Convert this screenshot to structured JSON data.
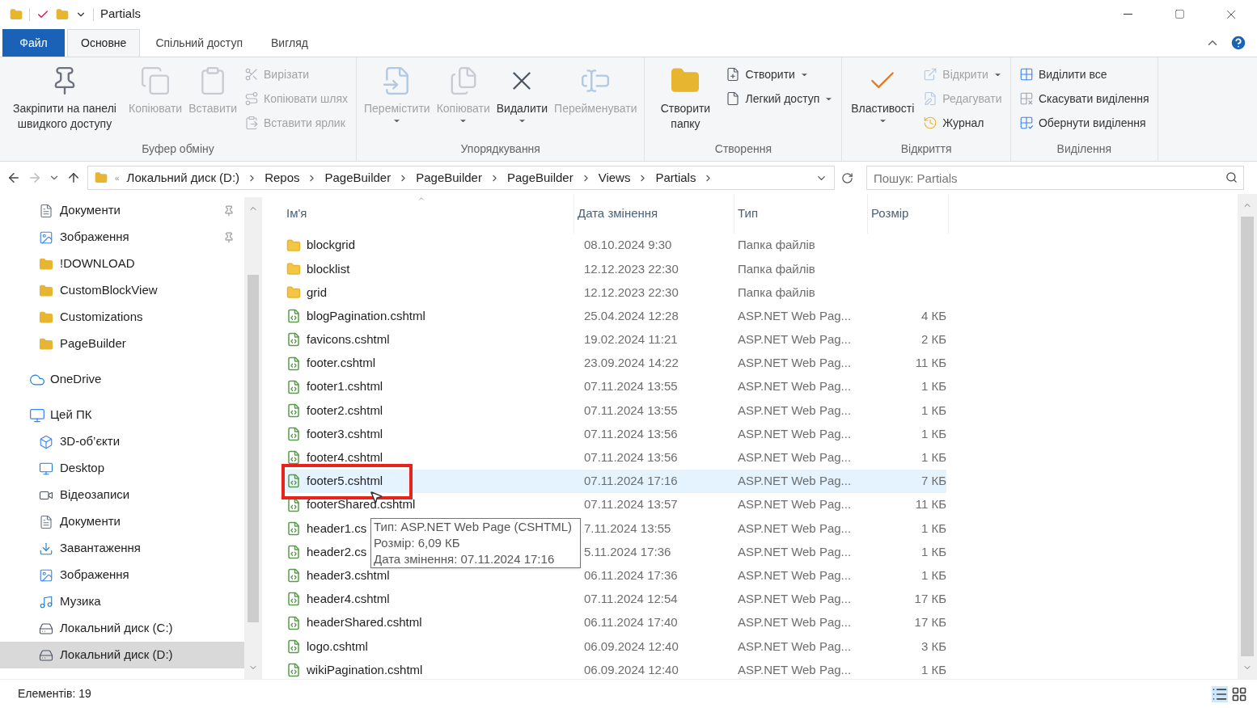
{
  "window": {
    "title": "Partials"
  },
  "ribbon_tabs": [
    {
      "label": "Файл",
      "kind": "file",
      "selected": false
    },
    {
      "label": "Основне",
      "kind": "tab",
      "selected": true
    },
    {
      "label": "Спільний доступ",
      "kind": "tab",
      "selected": false
    },
    {
      "label": "Вигляд",
      "kind": "tab",
      "selected": false
    }
  ],
  "ribbon_groups": [
    {
      "label": "Буфер обміну",
      "large": [
        {
          "label": "Закріпити на панелі швидкого доступу",
          "kind": "pin",
          "disabled": false,
          "dropdown": false
        },
        {
          "label": "Копіювати",
          "kind": "copy",
          "disabled": true,
          "dropdown": false
        },
        {
          "label": "Вставити",
          "kind": "paste",
          "disabled": true,
          "dropdown": false
        }
      ],
      "small": [
        {
          "label": "Вирізати",
          "kind": "cut",
          "disabled": true,
          "dropdown": false
        },
        {
          "label": "Копіювати шлях",
          "kind": "copy_path",
          "disabled": true,
          "dropdown": false
        },
        {
          "label": "Вставити ярлик",
          "kind": "paste_shortcut",
          "disabled": true,
          "dropdown": false
        }
      ]
    },
    {
      "label": "Упорядкування",
      "large": [
        {
          "label": "Перемістити",
          "kind": "move",
          "disabled": true,
          "dropdown": true
        },
        {
          "label": "Копіювати",
          "kind": "copy_to",
          "disabled": true,
          "dropdown": true
        },
        {
          "label": "Видалити",
          "kind": "delete",
          "disabled": false,
          "dropdown": true
        },
        {
          "label": "Перейменувати",
          "kind": "rename",
          "disabled": true,
          "dropdown": false
        }
      ]
    },
    {
      "label": "Створення",
      "large": [
        {
          "label": "Створити папку",
          "kind": "new_folder",
          "disabled": false,
          "dropdown": false
        }
      ],
      "small": [
        {
          "label": "Створити",
          "kind": "new_item",
          "disabled": false,
          "dropdown": true
        },
        {
          "label": "Легкий доступ",
          "kind": "easy_access",
          "disabled": false,
          "dropdown": true
        }
      ]
    },
    {
      "label": "Відкриття",
      "large": [
        {
          "label": "Властивості",
          "kind": "properties",
          "disabled": false,
          "dropdown": true
        }
      ],
      "small": [
        {
          "label": "Відкрити",
          "kind": "open",
          "disabled": true,
          "dropdown": true
        },
        {
          "label": "Редагувати",
          "kind": "edit",
          "disabled": true,
          "dropdown": false
        },
        {
          "label": "Журнал",
          "kind": "history",
          "disabled": false,
          "dropdown": false
        }
      ]
    },
    {
      "label": "Виділення",
      "small": [
        {
          "label": "Виділити все",
          "kind": "select_all",
          "disabled": false,
          "dropdown": false
        },
        {
          "label": "Скасувати виділення",
          "kind": "select_none",
          "disabled": false,
          "dropdown": false
        },
        {
          "label": "Обернути виділення",
          "kind": "invert",
          "disabled": false,
          "dropdown": false
        }
      ]
    }
  ],
  "address": {
    "overflow": "«",
    "path": [
      "Локальний диск (D:)",
      "Repos",
      "PageBuilder",
      "PageBuilder",
      "PageBuilder",
      "Views",
      "Partials"
    ]
  },
  "search": {
    "placeholder": "Пошук: Partials"
  },
  "sidebar": {
    "quick_access": [
      {
        "label": "Документи",
        "kind": "docs",
        "pinned": true,
        "selected": false
      },
      {
        "label": "Зображення",
        "kind": "pictures",
        "pinned": true,
        "selected": false
      },
      {
        "label": "!DOWNLOAD",
        "kind": "folder",
        "pinned": false,
        "selected": false
      },
      {
        "label": "CustomBlockView",
        "kind": "folder",
        "pinned": false,
        "selected": false
      },
      {
        "label": "Customizations",
        "kind": "folder",
        "pinned": false,
        "selected": false
      },
      {
        "label": "PageBuilder",
        "kind": "folder",
        "pinned": false,
        "selected": false
      }
    ],
    "tree": [
      {
        "label": "OneDrive",
        "kind": "cloud",
        "selected": false
      },
      {
        "label": "Цей ПК",
        "kind": "pc",
        "selected": false,
        "children": [
          {
            "label": "3D-об’єкти",
            "kind": "objects",
            "selected": false
          },
          {
            "label": "Desktop",
            "kind": "desktop",
            "selected": false
          },
          {
            "label": "Відеозаписи",
            "kind": "video",
            "selected": false
          },
          {
            "label": "Документи",
            "kind": "docs",
            "selected": false
          },
          {
            "label": "Завантаження",
            "kind": "download",
            "selected": false
          },
          {
            "label": "Зображення",
            "kind": "pictures",
            "selected": false
          },
          {
            "label": "Музика",
            "kind": "music",
            "selected": false
          },
          {
            "label": "Локальний диск (C:)",
            "kind": "drive",
            "selected": false
          },
          {
            "label": "Локальний диск (D:)",
            "kind": "drive",
            "selected": true
          }
        ]
      }
    ]
  },
  "table": {
    "columns": [
      "Ім'я",
      "Дата змінення",
      "Тип",
      "Розмір"
    ],
    "rows": [
      {
        "name": "blockgrid",
        "date": "08.10.2024 9:30",
        "type": "Папка файлів",
        "kind": "folder",
        "selected": false,
        "highlighted": false
      },
      {
        "name": "blocklist",
        "date": "12.12.2023 22:30",
        "type": "Папка файлів",
        "kind": "folder",
        "selected": false,
        "highlighted": false
      },
      {
        "name": "grid",
        "date": "12.12.2023 22:30",
        "type": "Папка файлів",
        "kind": "folder",
        "selected": false,
        "highlighted": false
      },
      {
        "name": "blogPagination.cshtml",
        "date": "25.04.2024 12:28",
        "type": "ASP.NET Web Pag...",
        "size": "4 КБ",
        "kind": "file",
        "selected": false,
        "highlighted": false
      },
      {
        "name": "favicons.cshtml",
        "date": "19.02.2024 11:21",
        "type": "ASP.NET Web Pag...",
        "size": "2 КБ",
        "kind": "file",
        "selected": false,
        "highlighted": false
      },
      {
        "name": "footer.cshtml",
        "date": "23.09.2024 14:22",
        "type": "ASP.NET Web Pag...",
        "size": "11 КБ",
        "kind": "file",
        "selected": false,
        "highlighted": false
      },
      {
        "name": "footer1.cshtml",
        "date": "07.11.2024 13:55",
        "type": "ASP.NET Web Pag...",
        "size": "1 КБ",
        "kind": "file",
        "selected": false,
        "highlighted": false
      },
      {
        "name": "footer2.cshtml",
        "date": "07.11.2024 13:55",
        "type": "ASP.NET Web Pag...",
        "size": "1 КБ",
        "kind": "file",
        "selected": false,
        "highlighted": false
      },
      {
        "name": "footer3.cshtml",
        "date": "07.11.2024 13:56",
        "type": "ASP.NET Web Pag...",
        "size": "1 КБ",
        "kind": "file",
        "selected": false,
        "highlighted": false
      },
      {
        "name": "footer4.cshtml",
        "date": "07.11.2024 13:56",
        "type": "ASP.NET Web Pag...",
        "size": "1 КБ",
        "kind": "file",
        "selected": false,
        "highlighted": false
      },
      {
        "name": "footer5.cshtml",
        "date": "07.11.2024 17:16",
        "type": "ASP.NET Web Pag...",
        "size": "7 КБ",
        "kind": "file",
        "selected": true,
        "highlighted": true
      },
      {
        "name": "footerShared.cshtml",
        "date": "07.11.2024 13:57",
        "type": "ASP.NET Web Pag...",
        "size": "11 КБ",
        "kind": "file",
        "selected": false,
        "highlighted": false
      },
      {
        "name": "header1.cs",
        "date": "7.11.2024 13:55",
        "type": "ASP.NET Web Pag...",
        "size": "1 КБ",
        "kind": "file",
        "selected": false,
        "highlighted": false
      },
      {
        "name": "header2.cs",
        "date": "5.11.2024 17:36",
        "type": "ASP.NET Web Pag...",
        "size": "1 КБ",
        "kind": "file",
        "selected": false,
        "highlighted": false
      },
      {
        "name": "header3.cshtml",
        "date": "06.11.2024 17:36",
        "type": "ASP.NET Web Pag...",
        "size": "1 КБ",
        "kind": "file",
        "selected": false,
        "highlighted": false
      },
      {
        "name": "header4.cshtml",
        "date": "07.11.2024 12:54",
        "type": "ASP.NET Web Pag...",
        "size": "17 КБ",
        "kind": "file",
        "selected": false,
        "highlighted": false
      },
      {
        "name": "headerShared.cshtml",
        "date": "06.11.2024 17:40",
        "type": "ASP.NET Web Pag...",
        "size": "17 КБ",
        "kind": "file",
        "selected": false,
        "highlighted": false
      },
      {
        "name": "logo.cshtml",
        "date": "06.09.2024 12:40",
        "type": "ASP.NET Web Pag...",
        "size": "3 КБ",
        "kind": "file",
        "selected": false,
        "highlighted": false
      },
      {
        "name": "wikiPagination.cshtml",
        "date": "06.09.2024 12:40",
        "type": "ASP.NET Web Pag...",
        "size": "1 КБ",
        "kind": "file",
        "selected": false,
        "highlighted": false
      }
    ]
  },
  "tooltip": {
    "lines": [
      "Тип: ASP.NET Web Page (CSHTML)",
      "Розмір: 6,09 КБ",
      "Дата змінення: 07.11.2024 17:16"
    ]
  },
  "status_bar": {
    "count": "Елементів: 19"
  }
}
